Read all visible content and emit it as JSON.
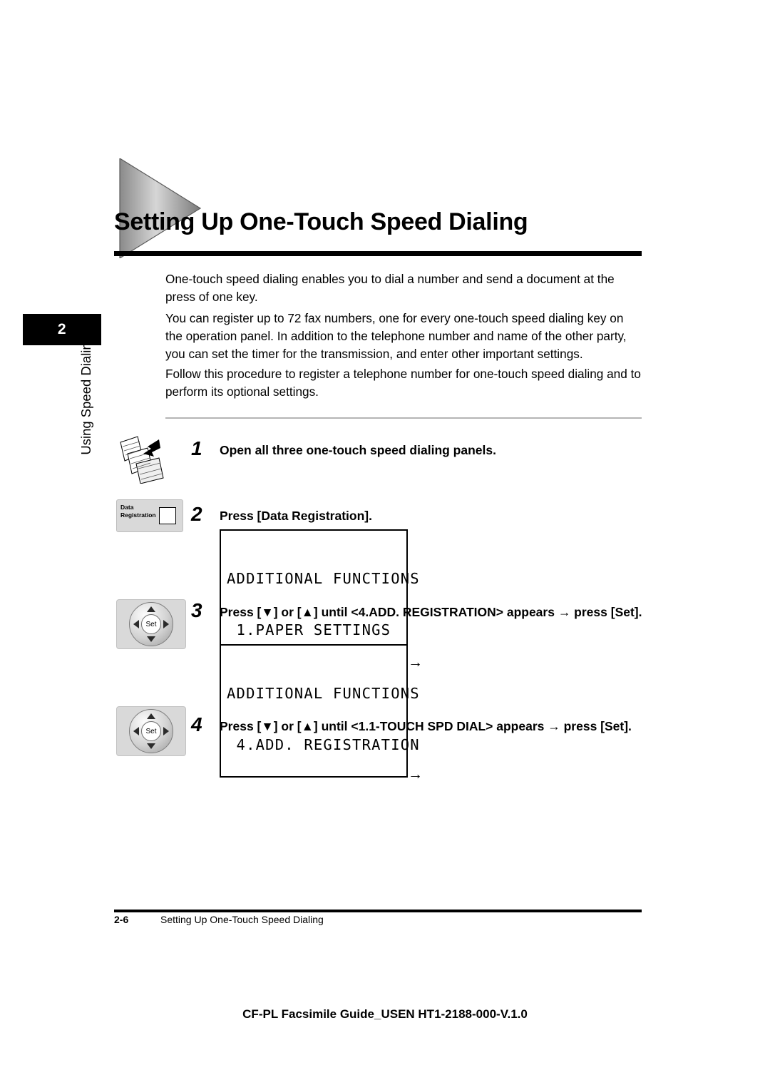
{
  "chapter": {
    "number": "2",
    "side_label": "Using Speed Dialing"
  },
  "header": {
    "title": "Setting Up One-Touch Speed Dialing"
  },
  "intro": {
    "paragraph1": "One-touch speed dialing enables you to dial a number and send a document at the press of one key.",
    "paragraph2": "You can register up to 72 fax numbers, one for every one-touch speed dialing key on the operation panel. In addition to the telephone number and name of the other party, you can set the timer for the transmission, and enter other important settings.",
    "paragraph3": "Follow this procedure to register a telephone number for one-touch speed dialing and to perform its optional settings."
  },
  "steps": [
    {
      "number": "1",
      "text": "Open all three one-touch speed dialing panels.",
      "icon": "one-touch-panels-icon"
    },
    {
      "number": "2",
      "text": "Press [Data Registration].",
      "icon": "data-registration-key-icon",
      "icon_label_line1": "Data",
      "icon_label_line2": "Registration",
      "lcd": {
        "line1": "ADDITIONAL FUNCTIONS",
        "line2": " 1.PAPER SETTINGS"
      }
    },
    {
      "number": "3",
      "text": "Press [▼] or [▲] until <4.ADD. REGISTRATION> appears → press [Set].",
      "icon": "arrow-pad-set-key-icon",
      "icon_center_label": "Set",
      "lcd": {
        "line1": "ADDITIONAL FUNCTIONS",
        "line2": " 4.ADD. REGISTRATION"
      },
      "trailing_arrow": "→"
    },
    {
      "number": "4",
      "text": "Press [▼] or [▲] until <1.1-TOUCH SPD DIAL> appears → press [Set].",
      "icon": "arrow-pad-set-key-icon",
      "icon_center_label": "Set",
      "trailing_arrow": "→"
    }
  ],
  "footer": {
    "page_number": "2-6",
    "running_title": "Setting Up One-Touch Speed Dialing",
    "document_id": "CF-PL Facsimile Guide_USEN HT1-2188-000-V.1.0"
  }
}
